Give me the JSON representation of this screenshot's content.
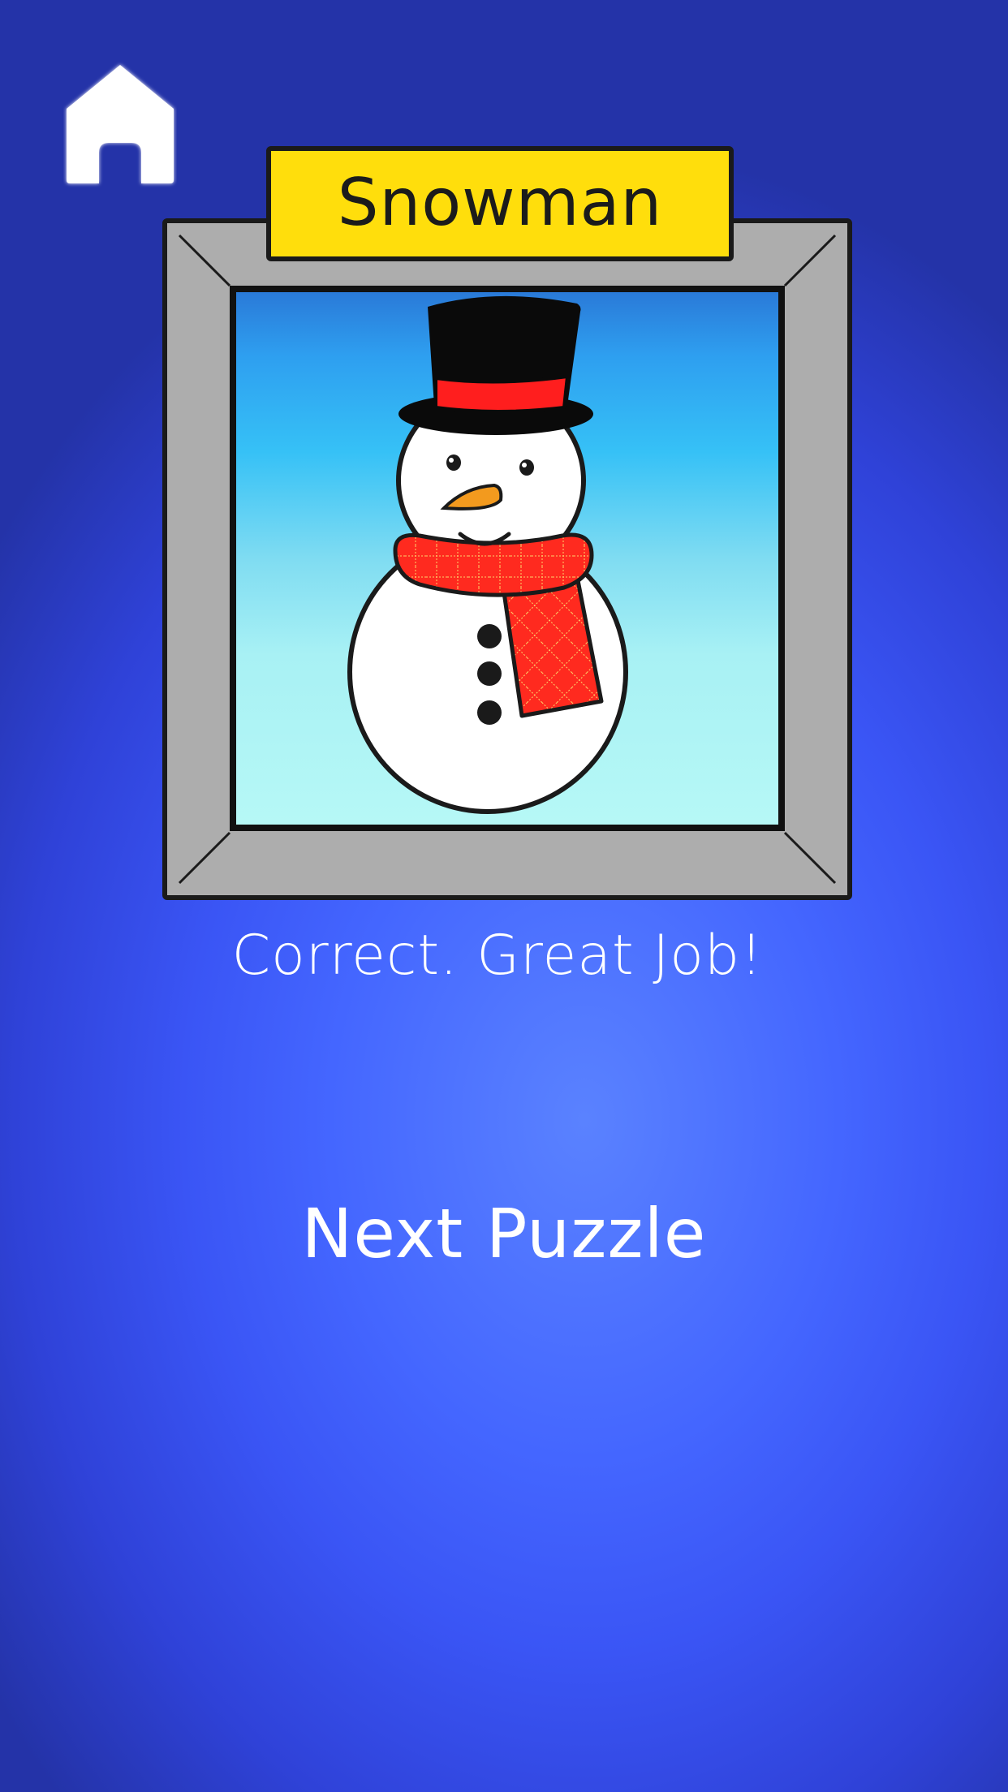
{
  "header": {
    "home_icon": "home-icon"
  },
  "puzzle": {
    "title": "Snowman",
    "image_subject": "snowman-picture"
  },
  "feedback": {
    "message": "Correct. Great Job!"
  },
  "actions": {
    "next_label": "Next Puzzle"
  },
  "colors": {
    "background": "#3a55f5",
    "title_plate": "#ffde0c",
    "frame": "#adadad",
    "hat_band": "#ff1e1e",
    "scarf": "#ff1e1e",
    "nose": "#f39a1e"
  }
}
